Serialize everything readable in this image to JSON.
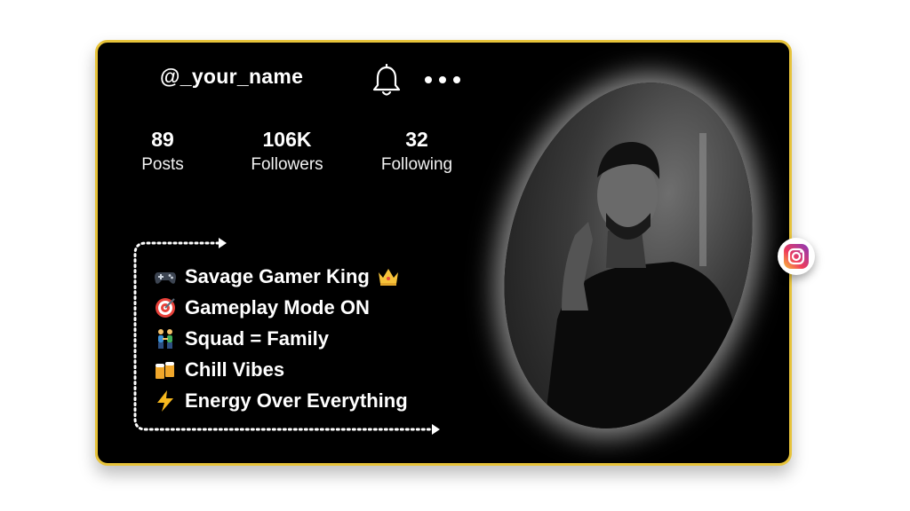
{
  "profile": {
    "username": "@_your_name",
    "stats": [
      {
        "value": "89",
        "label": "Posts"
      },
      {
        "value": "106K",
        "label": "Followers"
      },
      {
        "value": "32",
        "label": "Following"
      }
    ],
    "bio": [
      {
        "icon": "game-controller-icon",
        "text": "Savage Gamer King",
        "trailing_icon": "crown-icon"
      },
      {
        "icon": "target-icon",
        "text": "Gameplay Mode ON"
      },
      {
        "icon": "people-holding-hands-icon",
        "text": "Squad = Family"
      },
      {
        "icon": "beer-mugs-icon",
        "text": "Chill Vibes"
      },
      {
        "icon": "lightning-icon",
        "text": "Energy Over Everything"
      }
    ]
  },
  "colors": {
    "card_background": "#000000",
    "card_border": "#e7c33a",
    "text": "#ffffff"
  }
}
